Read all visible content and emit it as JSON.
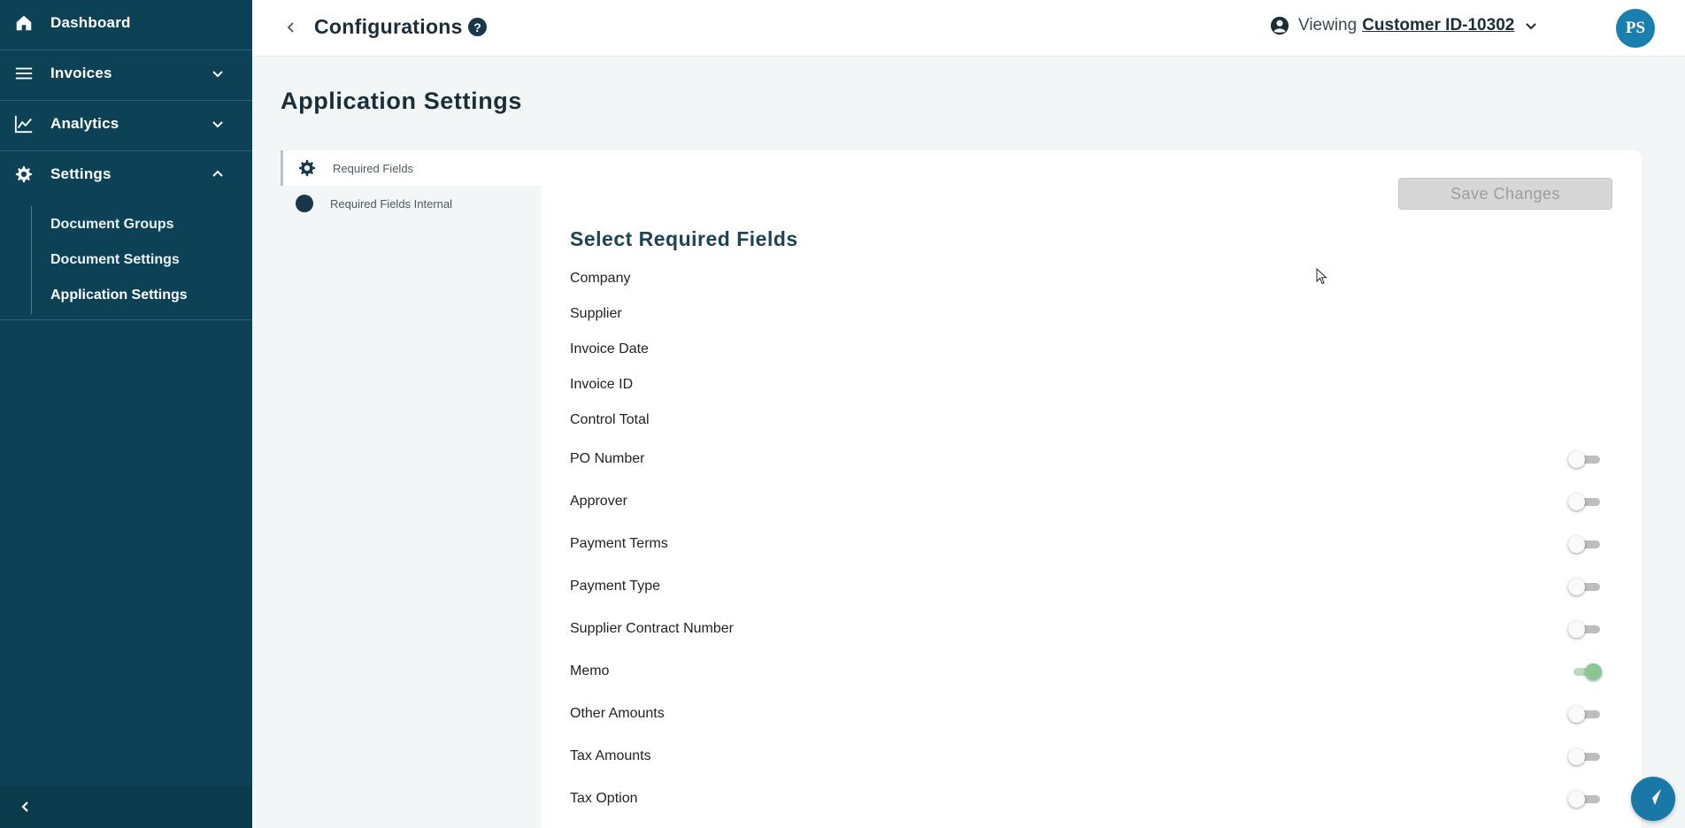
{
  "sidebar": {
    "nav": [
      {
        "label": "Dashboard",
        "icon": "home-icon"
      },
      {
        "label": "Invoices",
        "icon": "menu-lines-icon"
      },
      {
        "label": "Analytics",
        "icon": "line-chart-icon"
      },
      {
        "label": "Settings",
        "icon": "gear-icon"
      }
    ],
    "settings_sub": [
      {
        "label": "Document Groups"
      },
      {
        "label": "Document Settings"
      },
      {
        "label": "Application Settings"
      }
    ]
  },
  "header": {
    "title": "Configurations",
    "help_glyph": "?",
    "viewing_label": "Viewing",
    "customer": "Customer ID-10302",
    "avatar_initials": "PS"
  },
  "main": {
    "section_title": "Application Settings",
    "tabs": [
      {
        "label": "Required Fields"
      },
      {
        "label": "Required Fields Internal"
      }
    ],
    "save_label": "Save Changes",
    "fields_heading": "Select Required Fields",
    "fixed_fields": [
      "Company",
      "Supplier",
      "Invoice Date",
      "Invoice ID",
      "Control Total"
    ],
    "toggle_fields": [
      {
        "label": "PO Number",
        "on": false
      },
      {
        "label": "Approver",
        "on": false
      },
      {
        "label": "Payment Terms",
        "on": false
      },
      {
        "label": "Payment Type",
        "on": false
      },
      {
        "label": "Supplier Contract Number",
        "on": false
      },
      {
        "label": "Memo",
        "on": true
      },
      {
        "label": "Other Amounts",
        "on": false
      },
      {
        "label": "Tax Amounts",
        "on": false
      },
      {
        "label": "Tax Option",
        "on": false
      }
    ]
  },
  "colors": {
    "sidebar": "#0d4256",
    "accent": "#1a78a6",
    "toggle_on": "#8bc592"
  }
}
